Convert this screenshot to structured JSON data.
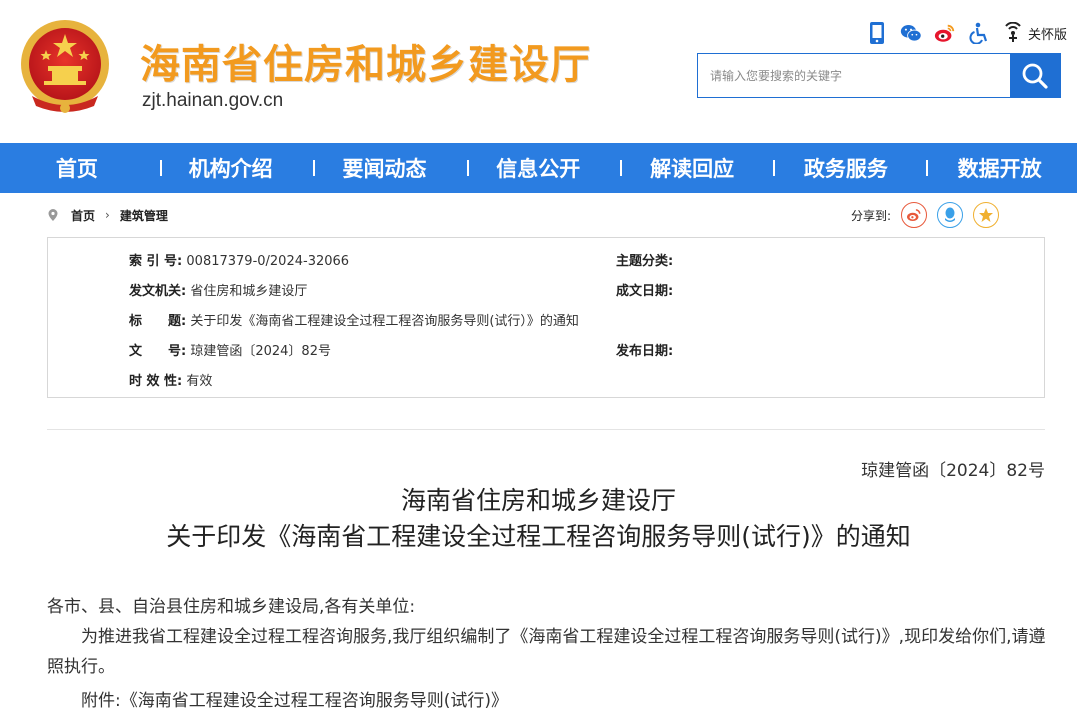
{
  "header": {
    "site_title": "海南省住房和城乡建设厅",
    "site_domain": "zjt.hainan.gov.cn",
    "tools": [
      "mobile-icon",
      "wechat-icon",
      "weibo-icon",
      "accessibility-icon",
      "care-mode-icon"
    ],
    "care_label": "关怀版",
    "search_placeholder": "请输入您要搜索的关键字"
  },
  "nav": {
    "items": [
      "首页",
      "机构介绍",
      "要闻动态",
      "信息公开",
      "解读回应",
      "政务服务",
      "数据开放"
    ]
  },
  "breadcrumb": {
    "home": "首页",
    "separator": "›",
    "current": "建筑管理"
  },
  "share": {
    "label": "分享到:",
    "targets": [
      "weibo-icon",
      "qq-icon",
      "qzone-icon"
    ]
  },
  "meta": {
    "index_label": "索 引 号:",
    "index_value": "00817379-0/2024-32066",
    "topic_label": "主题分类:",
    "topic_value": "",
    "issuer_label": "发文机关:",
    "issuer_value": "省住房和城乡建设厅",
    "date_formed_label": "成文日期:",
    "date_formed_value": "",
    "title_label": "标　　题:",
    "title_value": "关于印发《海南省工程建设全过程工程咨询服务导则(试行）》的通知",
    "docno_label": "文　　号:",
    "docno_value": "琼建管函〔2024〕82号",
    "publish_label": "发布日期:",
    "publish_value": "",
    "validity_label": "时 效 性:",
    "validity_value": "有效"
  },
  "document": {
    "number": "琼建管函〔2024〕82号",
    "title_line1": "海南省住房和城乡建设厅",
    "title_line2": "关于印发《海南省工程建设全过程工程咨询服务导则(试行)》的通知",
    "salutation": "各市、县、自治县住房和城乡建设局,各有关单位:",
    "para1": "为推进我省工程建设全过程工程咨询服务,我厅组织编制了《海南省工程建设全过程工程咨询服务导则(试行)》,现印发给你们,请遵照执行。",
    "attachment": "附件:《海南省工程建设全过程工程咨询服务导则(试行)》"
  },
  "colors": {
    "nav_bg": "#2a7de1",
    "title_orange": "#f29a1f",
    "search_blue": "#1f6fd3"
  }
}
